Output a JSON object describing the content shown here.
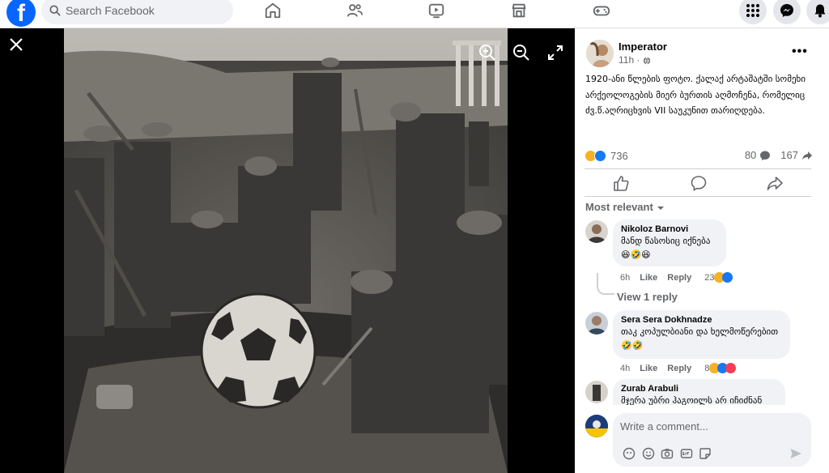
{
  "search": {
    "placeholder": "Search Facebook"
  },
  "nav": [
    "home-icon",
    "friends-icon",
    "video-icon",
    "marketplace-icon",
    "gaming-icon"
  ],
  "top_right": [
    "menu-grid-icon",
    "messenger-icon",
    "notifications-icon"
  ],
  "post": {
    "author": "Imperator",
    "time": "11h · ",
    "caption": "1920-ანი წლების ფოტო. ქალაქ არტაშატში სომეხი არქეოლოგების მიერ ბურთის აღმოჩენა, რომელიც ძვ.წ.აღრიცხვის VII საუკუნით თარიღდება.",
    "reaction_count": "736",
    "comment_count": "80",
    "share_count": "167"
  },
  "sort_label": "Most relevant",
  "comments": [
    {
      "name": "Nikoloz Barnovi",
      "text": "მანდ წასოსიც იქნება",
      "emoji_line": "😆🤣😆",
      "time": "6h",
      "like": "Like",
      "reply": "Reply",
      "reactions": "23"
    },
    {
      "name": "Sera Sera Dokhnadze",
      "text": "თაკ კოპულბიანი და ხელმოწერებით 🤣🤣",
      "time": "4h",
      "like": "Like",
      "reply": "Reply",
      "reactions": "8"
    },
    {
      "name": "Zurab Arabuli",
      "text": "მჯერა უბრი ჰაგოილს არ იჩიძნან"
    }
  ],
  "view_replies": "View 1 reply",
  "composer": {
    "placeholder": "Write a comment..."
  },
  "colors": {
    "brand": "#0866ff",
    "like_blue": "#1877f2",
    "haha_yellow": "#f7b125",
    "love_red": "#f33e58"
  }
}
